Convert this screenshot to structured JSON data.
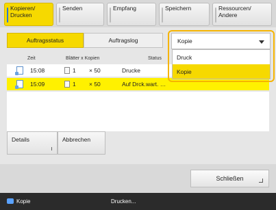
{
  "tabs": [
    {
      "label_line1": "Kopieren/",
      "label_line2": "Drucken"
    },
    {
      "label_line1": "Senden",
      "label_line2": ""
    },
    {
      "label_line1": "Empfang",
      "label_line2": ""
    },
    {
      "label_line1": "Speichern",
      "label_line2": ""
    },
    {
      "label_line1": "Ressourcen/",
      "label_line2": "Andere"
    }
  ],
  "subtabs": {
    "status": "Auftragsstatus",
    "log": "Auftragslog"
  },
  "filter": {
    "selected": "Kopie",
    "options": [
      "Druck",
      "Kopie"
    ]
  },
  "table": {
    "headers": [
      "Zeit",
      "Blätter x Kopien",
      "Status"
    ],
    "rows": [
      {
        "time": "15:08",
        "sheets": "1",
        "copies": "× 50",
        "status": "Drucke"
      },
      {
        "time": "15:09",
        "sheets": "1",
        "copies": "× 50",
        "status": "Auf Drck.wart. …"
      }
    ]
  },
  "buttons": {
    "details": "Details",
    "cancel": "Abbrechen",
    "close": "Schließen"
  },
  "statusbar": {
    "left": "Kopie",
    "mid": "Drucken..."
  },
  "colors": {
    "accent": "#f6d900",
    "selected_row": "#fff100",
    "focus": "#f6b400"
  }
}
